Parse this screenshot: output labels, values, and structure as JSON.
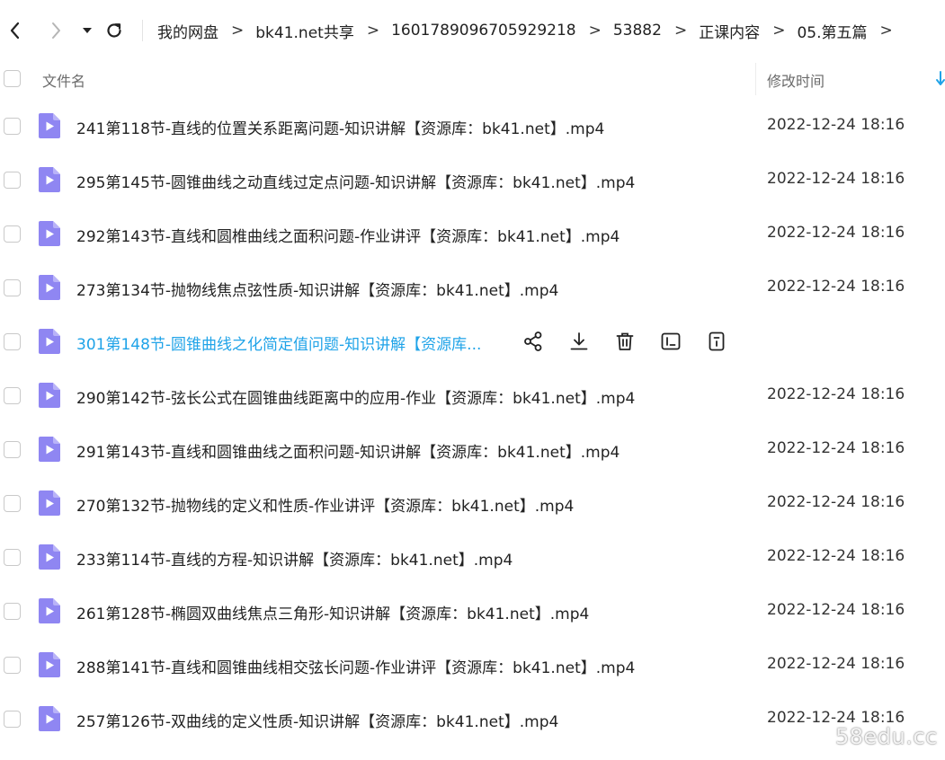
{
  "toolbar": {
    "back_icon": "chevron-left-icon",
    "forward_icon": "chevron-right-icon",
    "dropdown_icon": "caret-down-icon",
    "refresh_icon": "refresh-icon",
    "breadcrumb": [
      "我的网盘",
      "bk41.net共享",
      "1601789096705929218",
      "53882",
      "正课内容",
      "05.第五篇"
    ],
    "separator": ">"
  },
  "columns": {
    "name": "文件名",
    "modified": "修改时间",
    "sort_icon": "sort-down-icon"
  },
  "files": [
    {
      "name": "241第118节-直线的位置关系距离问题-知识讲解【资源库：bk41.net】.mp4",
      "modified": "2022-12-24 18:16"
    },
    {
      "name": "295第145节-圆锥曲线之动直线过定点问题-知识讲解【资源库：bk41.net】.mp4",
      "modified": "2022-12-24 18:16"
    },
    {
      "name": "292第143节-直线和圆椎曲线之面积问题-作业讲评【资源库：bk41.net】.mp4",
      "modified": "2022-12-24 18:16"
    },
    {
      "name": "273第134节-抛物线焦点弦性质-知识讲解【资源库：bk41.net】.mp4",
      "modified": "2022-12-24 18:16"
    },
    {
      "name": "301第148节-圆锥曲线之化简定值问题-知识讲解【资源库...",
      "modified": "",
      "hover": true
    },
    {
      "name": "290第142节-弦长公式在圆锥曲线距离中的应用-作业【资源库：bk41.net】.mp4",
      "modified": "2022-12-24 18:16"
    },
    {
      "name": "291第143节-直线和圆锥曲线之面积问题-知识讲解【资源库：bk41.net】.mp4",
      "modified": "2022-12-24 18:16"
    },
    {
      "name": "270第132节-抛物线的定义和性质-作业讲评【资源库：bk41.net】.mp4",
      "modified": "2022-12-24 18:16"
    },
    {
      "name": "233第114节-直线的方程-知识讲解【资源库：bk41.net】.mp4",
      "modified": "2022-12-24 18:16"
    },
    {
      "name": "261第128节-椭圆双曲线焦点三角形-知识讲解【资源库：bk41.net】.mp4",
      "modified": "2022-12-24 18:16"
    },
    {
      "name": "288第141节-直线和圆锥曲线相交弦长问题-作业讲评【资源库：bk41.net】.mp4",
      "modified": "2022-12-24 18:16"
    },
    {
      "name": "257第126节-双曲线的定义性质-知识讲解【资源库：bk41.net】.mp4",
      "modified": "2022-12-24 18:16"
    }
  ],
  "row_actions": [
    "share-icon",
    "download-icon",
    "delete-icon",
    "rename-icon",
    "details-icon"
  ],
  "watermark": "58edu.cc",
  "colors": {
    "file_icon": "#8f86f2",
    "hover_text": "#1fa3e8",
    "checkbox_border": "#c9c9c9"
  }
}
